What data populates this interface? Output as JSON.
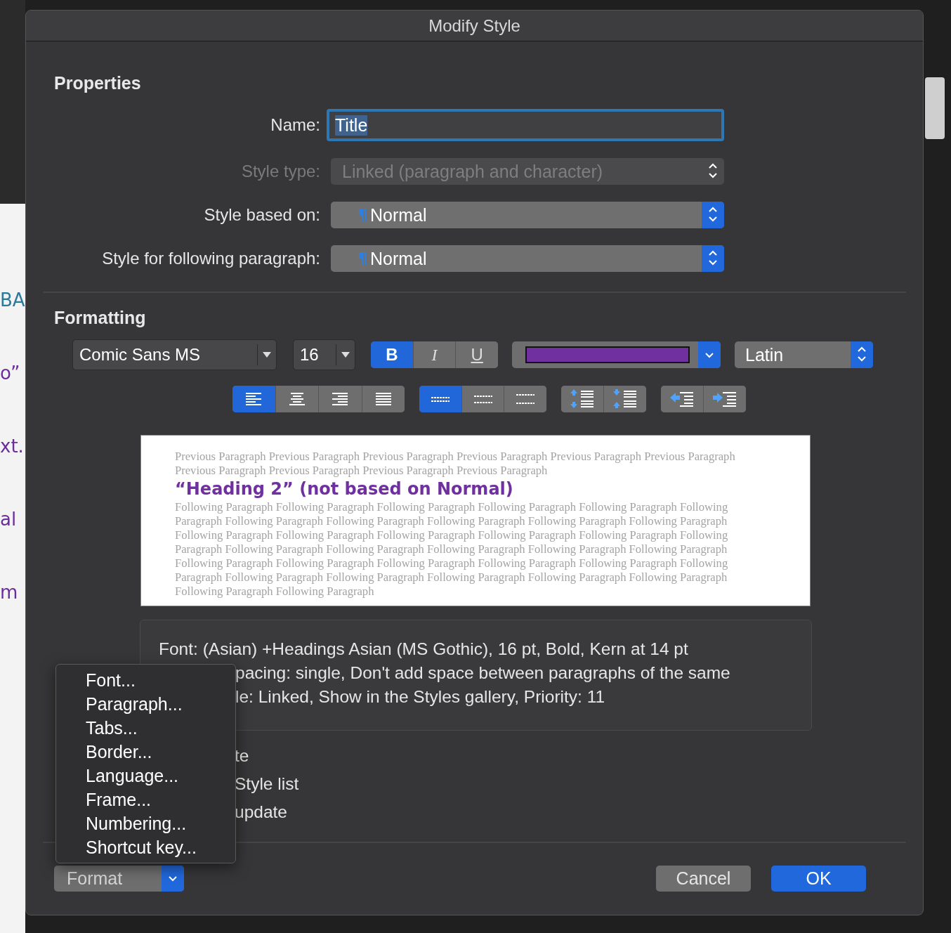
{
  "dialog": {
    "title": "Modify Style"
  },
  "properties": {
    "heading": "Properties",
    "name": {
      "label": "Name:",
      "value": "Title"
    },
    "style_type": {
      "label": "Style type:",
      "value": "Linked (paragraph and character)",
      "disabled": true
    },
    "style_based_on": {
      "label": "Style based on:",
      "value": "Normal",
      "disabled": false
    },
    "style_for_following": {
      "label": "Style for following paragraph:",
      "value": "Normal",
      "disabled": false
    }
  },
  "formatting": {
    "heading": "Formatting",
    "font": "Comic Sans MS",
    "size": "16",
    "styles": [
      {
        "label": "B",
        "kind": "bold",
        "selected": true
      },
      {
        "label": "I",
        "kind": "italic",
        "selected": false
      },
      {
        "label": "U",
        "kind": "underline",
        "selected": false
      }
    ],
    "font_color": {
      "color": "#7030a0"
    },
    "script": "Latin",
    "alignment": [
      {
        "kind": "left",
        "selected": true
      },
      {
        "kind": "center",
        "selected": false
      },
      {
        "kind": "right",
        "selected": false
      },
      {
        "kind": "justify",
        "selected": false
      }
    ],
    "line_spacing": [
      {
        "kind": "single",
        "selected": true
      },
      {
        "kind": "one_and_half",
        "selected": false
      },
      {
        "kind": "double",
        "selected": false
      }
    ],
    "paragraph_spacing": [
      {
        "kind": "increase"
      },
      {
        "kind": "decrease"
      }
    ],
    "indent": [
      {
        "kind": "decrease"
      },
      {
        "kind": "increase"
      }
    ]
  },
  "preview": {
    "previous_paragraph": "Previous Paragraph Previous Paragraph Previous Paragraph Previous Paragraph Previous Paragraph Previous Paragraph Previous Paragraph Previous Paragraph Previous Paragraph Previous Paragraph",
    "sample": "“Heading 2” (not based on Normal)",
    "following_paragraph": "Following Paragraph Following Paragraph Following Paragraph Following Paragraph Following Paragraph Following Paragraph Following Paragraph Following Paragraph Following Paragraph Following Paragraph Following Paragraph Following Paragraph Following Paragraph Following Paragraph Following Paragraph Following Paragraph Following Paragraph Following Paragraph Following Paragraph Following Paragraph Following Paragraph Following Paragraph Following Paragraph Following Paragraph Following Paragraph Following Paragraph Following Paragraph Following Paragraph Following Paragraph Following Paragraph Following Paragraph Following Paragraph Following Paragraph Following Paragraph Following Paragraph"
  },
  "description": [
    "Font: (Asian) +Headings Asian (MS Gothic), 16 pt, Bold, Kern at 14 pt",
    "pacing:  single, Don't add space between paragraphs of the same",
    "le: Linked, Show in the Styles gallery, Priority: 11"
  ],
  "options": [
    "te",
    "Style list",
    "update"
  ],
  "format_menu": {
    "items": [
      "Font...",
      "Paragraph...",
      "Tabs...",
      "Border...",
      "Language...",
      "Frame...",
      "Numbering...",
      "Shortcut key..."
    ]
  },
  "footer": {
    "format_button": "Format",
    "cancel": "Cancel",
    "ok": "OK"
  },
  "background_document": {
    "fragments": [
      {
        "text": "BA",
        "color": "#2a7a99"
      },
      {
        "text": "o”",
        "color": "#6a2d9c"
      },
      {
        "text": "xt.",
        "color": "#6a2d9c"
      },
      {
        "text": "al",
        "color": "#6a2d9c"
      },
      {
        "text": "m",
        "color": "#6a2d9c"
      }
    ]
  }
}
